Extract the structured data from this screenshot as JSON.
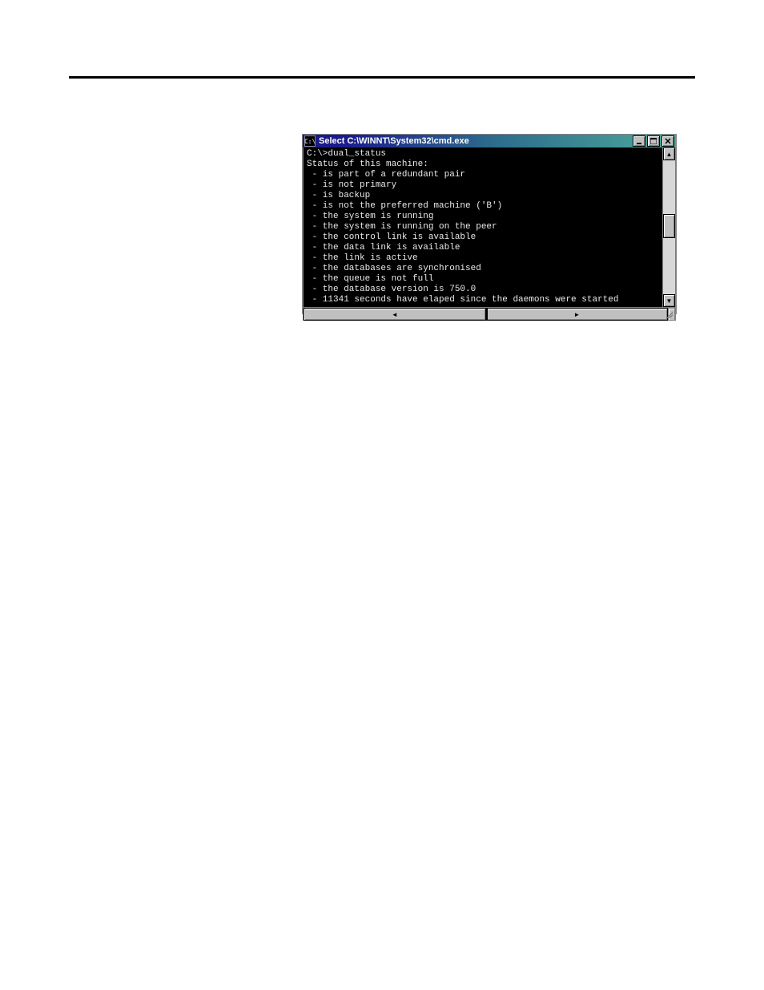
{
  "window": {
    "title": "Select C:\\WINNT\\System32\\cmd.exe",
    "sysicon_glyph": "C:\\"
  },
  "console": {
    "prompt": "C:\\>",
    "command": "dual_status",
    "header": "Status of this machine:",
    "lines": [
      "is part of a redundant pair",
      "is not primary",
      "is backup",
      "is not the preferred machine ('B')",
      "the system is running",
      "the system is running on the peer",
      "the control link is available",
      "the data link is available",
      "the link is active",
      "the databases are synchronised",
      "the queue is not full",
      "the database version is 750.0",
      "11341 seconds have elaped since the daemons were started"
    ]
  },
  "icons": {
    "minimize": "minimize",
    "maximize": "maximize",
    "close": "close",
    "scroll_up": "▲",
    "scroll_down": "▼",
    "scroll_left": "◄",
    "scroll_right": "►"
  }
}
